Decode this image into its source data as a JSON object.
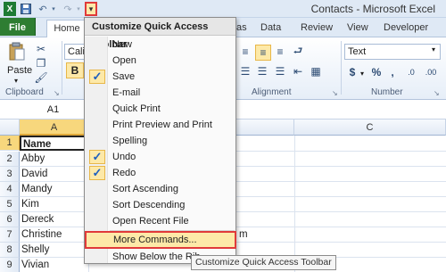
{
  "window": {
    "title": "Contacts - Microsoft Excel"
  },
  "tabs": [
    "File",
    "Home",
    "as",
    "Data",
    "Review",
    "View",
    "Developer"
  ],
  "ribbon": {
    "font_name": "Calib",
    "number_format": "Text",
    "groups": [
      "Clipboard",
      "Alignment",
      "Number"
    ],
    "paste_label": "Paste",
    "bold_label": "B",
    "currency_symbol": "$",
    "percent_symbol": "%",
    "comma_symbol": ","
  },
  "namebox": "A1",
  "columns": [
    "A",
    "C"
  ],
  "rows": [
    {
      "num": "1",
      "value": "Name",
      "bold": true
    },
    {
      "num": "2",
      "value": "Abby"
    },
    {
      "num": "3",
      "value": "David"
    },
    {
      "num": "4",
      "value": "Mandy"
    },
    {
      "num": "5",
      "value": "Kim"
    },
    {
      "num": "6",
      "value": "Dereck"
    },
    {
      "num": "7",
      "value": "Christine"
    },
    {
      "num": "8",
      "value": "Shelly"
    },
    {
      "num": "9",
      "value": "Vivian"
    }
  ],
  "cell_fragment": "m",
  "menu": {
    "title": "Customize Quick Access Toolbar",
    "items": [
      {
        "label": "New",
        "checked": false
      },
      {
        "label": "Open",
        "checked": false
      },
      {
        "label": "Save",
        "checked": true
      },
      {
        "label": "E-mail",
        "checked": false
      },
      {
        "label": "Quick Print",
        "checked": false
      },
      {
        "label": "Print Preview and Print",
        "checked": false
      },
      {
        "label": "Spelling",
        "checked": false
      },
      {
        "label": "Undo",
        "checked": true
      },
      {
        "label": "Redo",
        "checked": true
      },
      {
        "label": "Sort Ascending",
        "checked": false
      },
      {
        "label": "Sort Descending",
        "checked": false
      },
      {
        "label": "Open Recent File",
        "checked": false
      }
    ],
    "more_commands": "More Commands...",
    "show_below": "Show Below the Rib"
  },
  "tooltip": "Customize Quick Access Toolbar",
  "colors": {
    "file_tab": "#2e7d32",
    "highlight": "#fde9a8",
    "callout": "#e03a3a",
    "check": "#1d5fbf"
  }
}
